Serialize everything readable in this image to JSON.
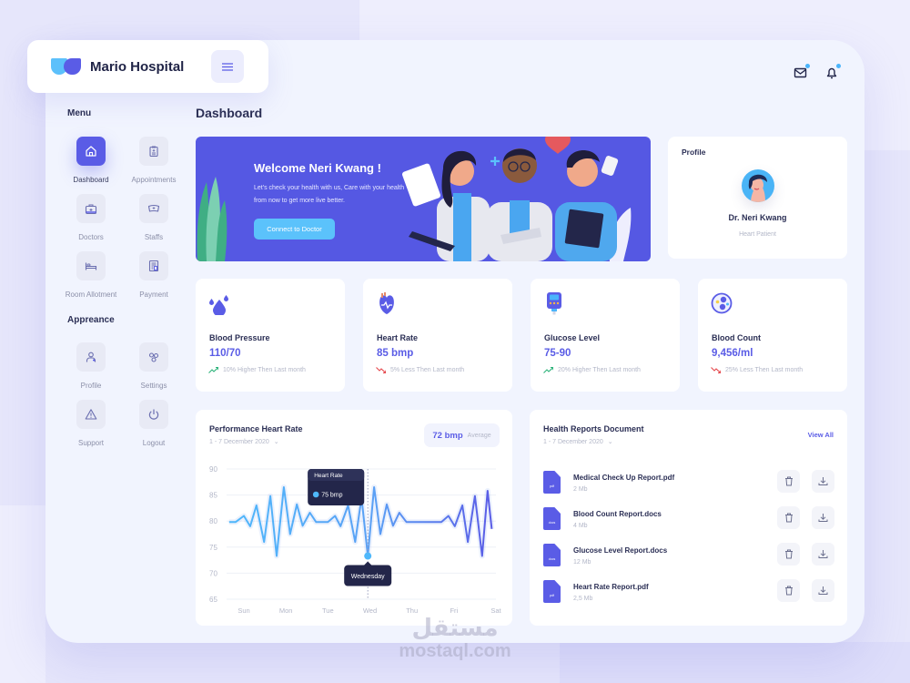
{
  "brand": {
    "name": "Mario Hospital"
  },
  "sidebar": {
    "menu_heading": "Menu",
    "menu_items": [
      {
        "label": "Dashboard",
        "icon": "home-icon",
        "active": true
      },
      {
        "label": "Appointments",
        "icon": "clipboard-icon",
        "active": false
      },
      {
        "label": "Doctors",
        "icon": "medical-kit-icon",
        "active": false
      },
      {
        "label": "Staffs",
        "icon": "nurse-cap-icon",
        "active": false
      },
      {
        "label": "Room Allotment",
        "icon": "bed-icon",
        "active": false
      },
      {
        "label": "Payment",
        "icon": "invoice-icon",
        "active": false
      }
    ],
    "appearance_heading": "Appreance",
    "appearance_items": [
      {
        "label": "Profile",
        "icon": "user-icon"
      },
      {
        "label": "Settings",
        "icon": "gears-icon"
      },
      {
        "label": "Support",
        "icon": "warning-icon"
      },
      {
        "label": "Logout",
        "icon": "power-icon"
      }
    ]
  },
  "header": {
    "page_title": "Dashboard",
    "mail_icon": "mail-icon",
    "bell_icon": "bell-icon"
  },
  "banner": {
    "title": "Welcome Neri Kwang !",
    "text": "Let's check your health with us, Care with your health from now to get more live better.",
    "button_label": "Connect to Doctor"
  },
  "profile": {
    "title": "Profile",
    "name": "Dr. Neri Kwang",
    "subtitle": "Heart Patient"
  },
  "stats": [
    {
      "label": "Blood Pressure",
      "value": "110/70",
      "trend": "10% Higher Then Last month",
      "direction": "up"
    },
    {
      "label": "Heart Rate",
      "value": "85 bmp",
      "trend": "5% Less Then Last month",
      "direction": "down"
    },
    {
      "label": "Glucose Level",
      "value": "75-90",
      "trend": "20% Higher Then Last month",
      "direction": "up"
    },
    {
      "label": "Blood Count",
      "value": "9,456/ml",
      "trend": "25% Less Then Last month",
      "direction": "down"
    }
  ],
  "colors": {
    "accent": "#5a5ce6",
    "sky": "#5bc2fb",
    "up": "#2db37a",
    "down": "#e5484d",
    "dark": "#23264a"
  },
  "heart_chart": {
    "title": "Performance Heart Rate",
    "date_range": "1 - 7 December 2020",
    "average_value": "72 bmp",
    "average_label": "Average",
    "tooltip_title": "Heart Rate",
    "tooltip_value": "75 bmp",
    "tooltip_day": "Wednesday"
  },
  "chart_data": {
    "type": "line",
    "title": "Performance Heart Rate",
    "xlabel": "",
    "ylabel": "",
    "ylim": [
      65,
      90
    ],
    "yticks": [
      90,
      85,
      80,
      75,
      70,
      65
    ],
    "categories": [
      "Sun",
      "Mon",
      "Tue",
      "Wed",
      "Thu",
      "Fri",
      "Sat"
    ],
    "xlim": [
      0,
      6
    ],
    "grid": true,
    "series": [
      {
        "name": "Heart Rate",
        "x": [
          -0.35,
          -0.2,
          0.0,
          0.15,
          0.3,
          0.48,
          0.63,
          0.78,
          0.95,
          1.1,
          1.26,
          1.4,
          1.57,
          1.72,
          2.0,
          2.17,
          2.3,
          2.48,
          2.65,
          2.8,
          2.95,
          3.1,
          3.25,
          3.4,
          3.55,
          3.7,
          3.87,
          4.7,
          4.87,
          5.02,
          5.2,
          5.33,
          5.5,
          5.67,
          5.8,
          5.9
        ],
        "y": [
          79.8,
          79.8,
          81,
          79,
          83,
          76,
          84.8,
          73.3,
          86.5,
          77.5,
          83.2,
          79.1,
          81.6,
          79.8,
          79.8,
          81,
          79,
          83,
          76,
          84.5,
          73.3,
          86.5,
          77.5,
          83.2,
          79.1,
          81.6,
          79.8,
          79.8,
          81,
          79,
          83,
          76,
          84.8,
          73.3,
          85.8,
          78.5
        ]
      }
    ],
    "highlight": {
      "x": 2.95,
      "label": "Wednesday",
      "value_text": "75 bmp"
    }
  },
  "reports": {
    "title": "Health Reports Document",
    "date_range": "1 - 7 December 2020",
    "view_all": "View All",
    "items": [
      {
        "name": "Medical Check Up Report.pdf",
        "size": "2 Mb",
        "type": "pdf"
      },
      {
        "name": "Blood Count Report.docs",
        "size": "4 Mb",
        "type": "docs"
      },
      {
        "name": "Glucose Level Report.docs",
        "size": "12 Mb",
        "type": "docs"
      },
      {
        "name": "Heart Rate Report.pdf",
        "size": "2,5 Mb",
        "type": "pdf"
      }
    ]
  },
  "watermark": {
    "arabic": "مستقل",
    "latin": "mostaql.com"
  }
}
